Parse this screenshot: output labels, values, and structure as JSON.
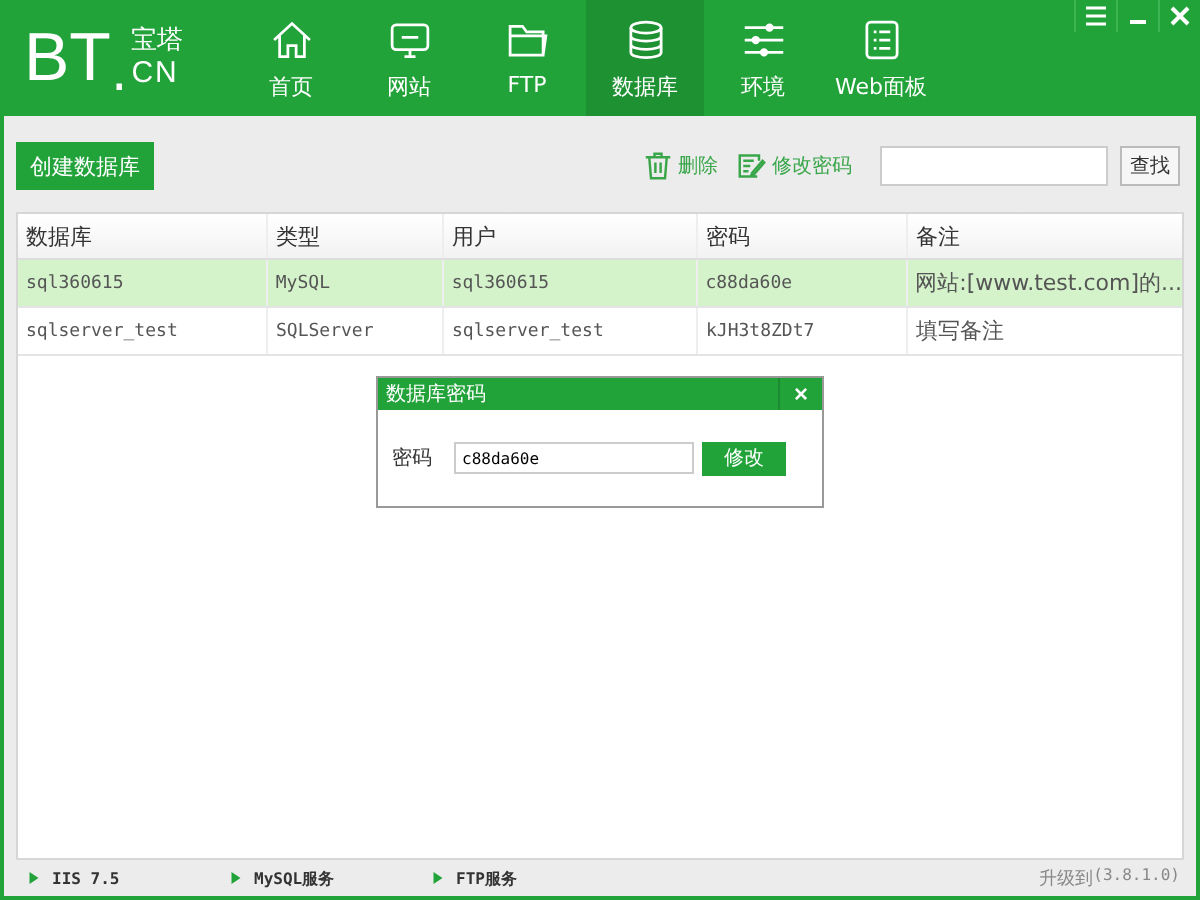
{
  "logo": {
    "main": "BT",
    "dot": ".",
    "top": "宝塔",
    "bottom": "CN"
  },
  "nav": [
    {
      "label": "首页",
      "selected": false
    },
    {
      "label": "网站",
      "selected": false
    },
    {
      "label": "FTP",
      "selected": false
    },
    {
      "label": "数据库",
      "selected": true
    },
    {
      "label": "环境",
      "selected": false
    },
    {
      "label": "Web面板",
      "selected": false
    }
  ],
  "toolbar": {
    "create": "创建数据库",
    "delete": "删除",
    "change_password": "修改密码",
    "search_button": "查找"
  },
  "table": {
    "columns": [
      "数据库",
      "类型",
      "用户",
      "密码",
      "备注"
    ],
    "rows": [
      {
        "selected": true,
        "cells": [
          "sql360615",
          "MySQL",
          "sql360615",
          "c88da60e",
          "网站:[www.test.com]的..."
        ]
      },
      {
        "selected": false,
        "cells": [
          "sqlserver_test",
          "SQLServer",
          "sqlserver_test",
          "kJH3t8ZDt7",
          "填写备注"
        ]
      }
    ]
  },
  "dialog": {
    "title": "数据库密码",
    "close": "×",
    "label": "密码",
    "value": "c88da60e",
    "button": "修改"
  },
  "status_bar": {
    "services": [
      "IIS 7.5",
      "MySQL服务",
      "FTP服务"
    ],
    "upgrade": "升级到",
    "version": "(3.8.1.0)"
  }
}
